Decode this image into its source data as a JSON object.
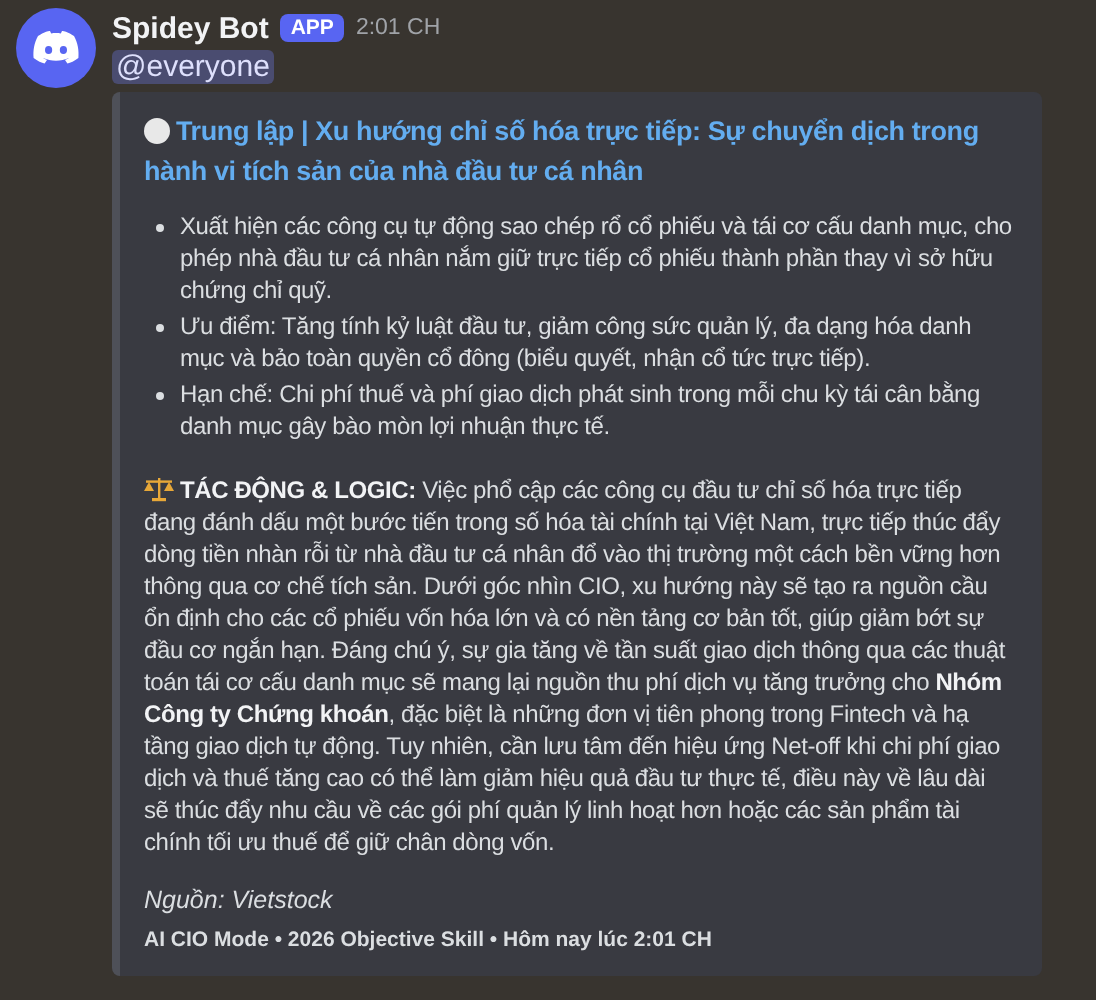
{
  "message": {
    "author": "Spidey Bot",
    "badge": "APP",
    "time": "2:01 CH",
    "mention": "@everyone"
  },
  "embed": {
    "title": "Trung lập | Xu hướng chỉ số hóa trực tiếp: Sự chuyển dịch trong hành vi tích sản của nhà đầu tư cá nhân",
    "bullets": [
      "Xuất hiện các công cụ tự động sao chép rổ cổ phiếu và tái cơ cấu danh mục, cho phép nhà đầu tư cá nhân nắm giữ trực tiếp cổ phiếu thành phần thay vì sở hữu chứng chỉ quỹ.",
      "Ưu điểm: Tăng tính kỷ luật đầu tư, giảm công sức quản lý, đa dạng hóa danh mục và bảo toàn quyền cổ đông (biểu quyết, nhận cổ tức trực tiếp).",
      "Hạn chế: Chi phí thuế và phí giao dịch phát sinh trong mỗi chu kỳ tái cân bằng danh mục gây bào mòn lợi nhuận thực tế."
    ],
    "impact": "**TÁC ĐỘNG & LOGIC:** Việc phổ cập các công cụ đầu tư chỉ số hóa trực tiếp đang đánh dấu một bước tiến trong số hóa tài chính tại Việt Nam, trực tiếp thúc đẩy dòng tiền nhàn rỗi từ nhà đầu tư cá nhân đổ vào thị trường một cách bền vững hơn thông qua cơ chế tích sản. Dưới góc nhìn CIO, xu hướng này sẽ tạo ra nguồn cầu ổn định cho các cổ phiếu vốn hóa lớn và có nền tảng cơ bản tốt, giúp giảm bớt sự đầu cơ ngắn hạn. Đáng chú ý, sự gia tăng về tần suất giao dịch thông qua các thuật toán tái cơ cấu danh mục sẽ mang lại nguồn thu phí dịch vụ tăng trưởng cho **Nhóm Công ty Chứng khoán**, đặc biệt là những đơn vị tiên phong trong Fintech và hạ tầng giao dịch tự động. Tuy nhiên, cần lưu tâm đến hiệu ứng Net-off khi chi phí giao dịch và thuế tăng cao có thể làm giảm hiệu quả đầu tư thực tế, điều này về lâu dài sẽ thúc đẩy nhu cầu về các gói phí quản lý linh hoạt hơn hoặc các sản phẩm tài chính tối ưu thuế để giữ chân dòng vốn.",
    "source": "Nguồn: Vietstock",
    "footer": "AI CIO Mode • 2026 Objective Skill • Hôm nay lúc 2:01 CH"
  }
}
